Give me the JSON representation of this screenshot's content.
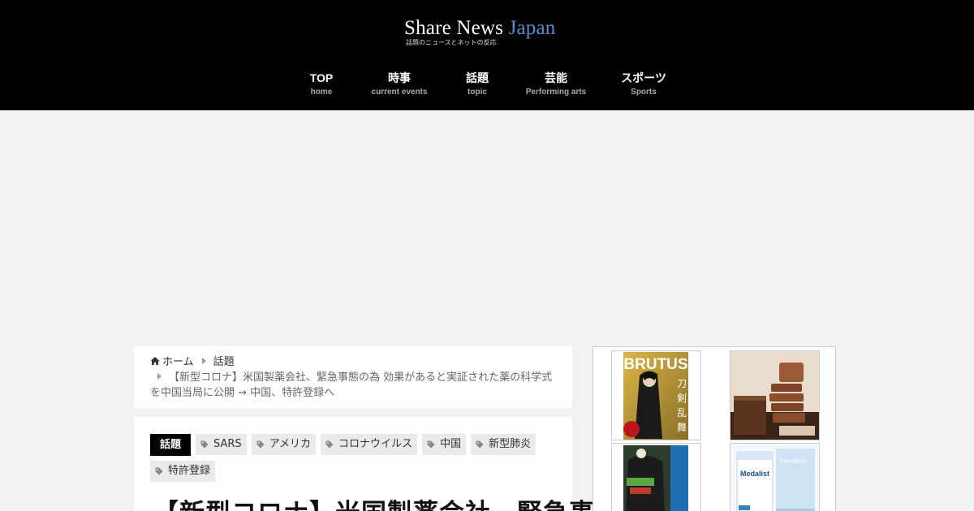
{
  "site": {
    "title_main": "Share News",
    "title_accent": "Japan",
    "tagline": "話題のニュースとネットの反応"
  },
  "nav": [
    {
      "label": "TOP",
      "sub": "home"
    },
    {
      "label": "時事",
      "sub": "current events"
    },
    {
      "label": "話題",
      "sub": "topic"
    },
    {
      "label": "芸能",
      "sub": "Performing arts"
    },
    {
      "label": "スポーツ",
      "sub": "Sports"
    }
  ],
  "breadcrumb": {
    "home": "ホーム",
    "category": "話題",
    "current": "【新型コロナ】米国製薬会社、緊急事態の為 効果があると実証された薬の科学式を中国当局に公開 → 中国、特許登録へ"
  },
  "article": {
    "category": "話題",
    "tags": [
      "SARS",
      "アメリカ",
      "コロナウイルス",
      "中国",
      "新型肺炎",
      "特許登録"
    ],
    "title": "【新型コロナ】米国製薬会社、緊急事"
  },
  "sidebar": {
    "magazine_text": "BRUTUS",
    "magazine_kanji": [
      "刀",
      "剣",
      "乱",
      "舞"
    ],
    "product_brand": "Medalist",
    "product_box": "Towelbox"
  },
  "colors": {
    "header_bg": "#000000",
    "accent_blue": "#5b8fd0",
    "page_bg": "#f2f2f2"
  }
}
